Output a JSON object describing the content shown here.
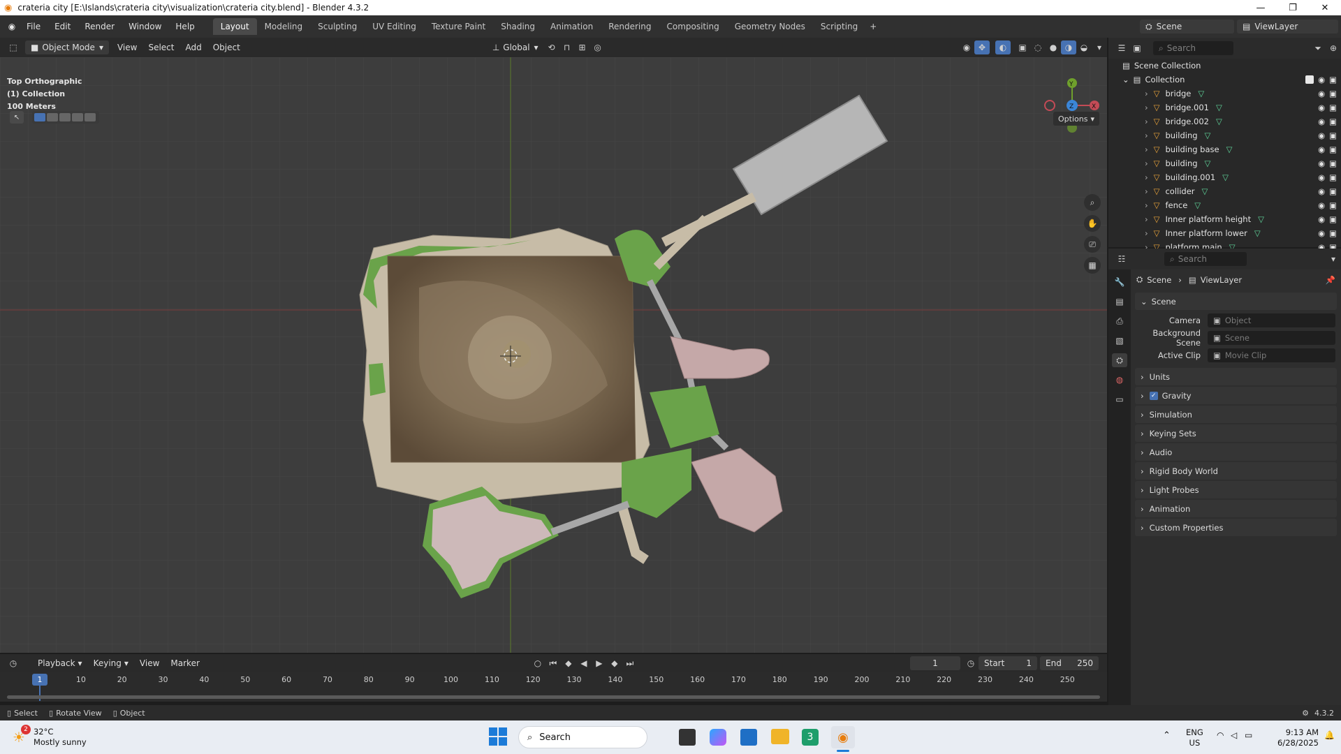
{
  "window": {
    "title": "crateria city [E:\\Islands\\crateria city\\visualization\\crateria city.blend] - Blender 4.3.2"
  },
  "menu": [
    "File",
    "Edit",
    "Render",
    "Window",
    "Help"
  ],
  "workspaces": [
    "Layout",
    "Modeling",
    "Sculpting",
    "UV Editing",
    "Texture Paint",
    "Shading",
    "Animation",
    "Rendering",
    "Compositing",
    "Geometry Nodes",
    "Scripting"
  ],
  "active_workspace": "Layout",
  "scene_selector": {
    "scene": "Scene",
    "view_layer": "ViewLayer"
  },
  "viewport_header": {
    "mode": "Object Mode",
    "items": [
      "View",
      "Select",
      "Add",
      "Object"
    ],
    "orientation": "Global"
  },
  "viewport": {
    "view_name": "Top Orthographic",
    "collection": "(1) Collection",
    "scale": "100 Meters",
    "options_label": "Options"
  },
  "gizmo": {
    "y": "Y",
    "z": "Z",
    "x": "X"
  },
  "outliner": {
    "search_placeholder": "Search",
    "root": "Scene Collection",
    "collection": "Collection",
    "items": [
      "bridge",
      "bridge.001",
      "bridge.002",
      "building",
      "building base",
      "building",
      "building.001",
      "collider",
      "fence",
      "Inner platform height",
      "Inner platform lower",
      "platform main"
    ]
  },
  "properties": {
    "search_placeholder": "Search",
    "breadcrumb": [
      "Scene",
      "ViewLayer"
    ],
    "section": "Scene",
    "fields": [
      {
        "label": "Camera",
        "placeholder": "Object"
      },
      {
        "label": "Background Scene",
        "placeholder": "Scene"
      },
      {
        "label": "Active Clip",
        "placeholder": "Movie Clip"
      }
    ],
    "panels": [
      "Units",
      "Gravity",
      "Simulation",
      "Keying Sets",
      "Audio",
      "Rigid Body World",
      "Light Probes",
      "Animation",
      "Custom Properties"
    ]
  },
  "timeline": {
    "menus": [
      "Playback",
      "Keying",
      "View",
      "Marker"
    ],
    "current_frame": "1",
    "start_label": "Start",
    "start": "1",
    "end_label": "End",
    "end": "250",
    "ticks": [
      "10",
      "20",
      "30",
      "40",
      "50",
      "60",
      "70",
      "80",
      "90",
      "100",
      "110",
      "120",
      "130",
      "140",
      "150",
      "160",
      "170",
      "180",
      "190",
      "200",
      "210",
      "220",
      "230",
      "240",
      "250"
    ],
    "playhead": "1"
  },
  "statusbar": {
    "items": [
      "Select",
      "Rotate View",
      "Object"
    ],
    "version": "4.3.2"
  },
  "taskbar": {
    "weather_temp": "32°C",
    "weather_desc": "Mostly sunny",
    "weather_badge": "2",
    "search": "Search",
    "lang": "ENG",
    "region": "US",
    "time": "9:13 AM",
    "date": "6/28/2025"
  }
}
